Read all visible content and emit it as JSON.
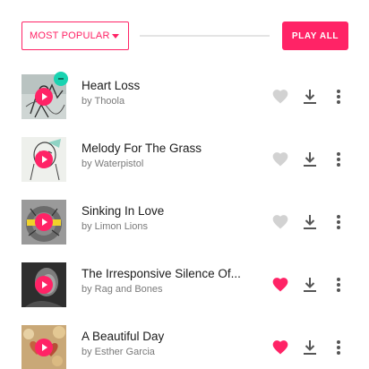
{
  "header": {
    "sort_dropdown": {
      "label": "MOST POPULAR"
    },
    "play_all_label": "PLAY ALL"
  },
  "colors": {
    "accent": "#ff2366",
    "heart_inactive": "#d2d2d2",
    "icon": "#555555",
    "teal_badge": "#19d3b1"
  },
  "tracks": [
    {
      "title": "Heart Loss",
      "artist": "by Thoola",
      "liked": false,
      "art": "line-art-figure"
    },
    {
      "title": "Melody For The Grass",
      "artist": "by Waterpistol",
      "liked": false,
      "art": "line-art-face"
    },
    {
      "title": "Sinking In Love",
      "artist": "by Limon Lions",
      "liked": false,
      "art": "lion-with-yellow-band"
    },
    {
      "title": "The Irresponsive Silence Of...",
      "artist": "by Rag and Bones",
      "liked": true,
      "art": "portrait-bw"
    },
    {
      "title": "A Beautiful Day",
      "artist": "by Esther Garcia",
      "liked": true,
      "art": "hearts-bokeh"
    }
  ]
}
